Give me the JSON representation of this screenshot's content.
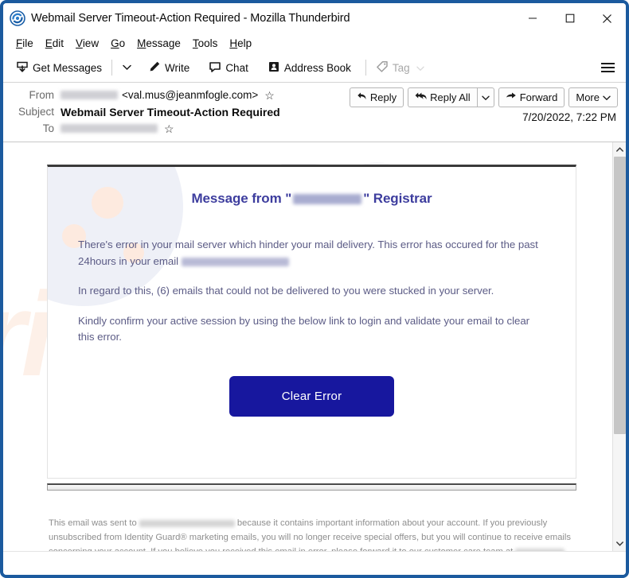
{
  "window": {
    "title": "Webmail Server Timeout-Action Required - Mozilla Thunderbird",
    "logo_icon": "thunderbird-logo-icon",
    "minimize_icon": "minimize-icon",
    "maximize_icon": "maximize-icon",
    "close_icon": "close-icon"
  },
  "menubar": {
    "items": [
      {
        "label": "File",
        "accesskey": "F"
      },
      {
        "label": "Edit",
        "accesskey": "E"
      },
      {
        "label": "View",
        "accesskey": "V"
      },
      {
        "label": "Go",
        "accesskey": "G"
      },
      {
        "label": "Message",
        "accesskey": "M"
      },
      {
        "label": "Tools",
        "accesskey": "T"
      },
      {
        "label": "Help",
        "accesskey": "H"
      }
    ]
  },
  "toolbar": {
    "get_messages": "Get Messages",
    "get_messages_icon": "download-inbox-icon",
    "get_messages_chevron_icon": "chevron-down-icon",
    "write": "Write",
    "write_icon": "pencil-icon",
    "chat": "Chat",
    "chat_icon": "chat-bubble-icon",
    "address_book": "Address Book",
    "address_book_icon": "address-card-icon",
    "tag": "Tag",
    "tag_icon": "tag-icon",
    "tag_chevron_icon": "chevron-down-icon",
    "app_menu_icon": "hamburger-menu-icon"
  },
  "message_header": {
    "from_label": "From",
    "from_name_redacted": true,
    "from_address": "<val.mus@jeanmfogle.com>",
    "from_star_icon": "star-outline-icon",
    "subject_label": "Subject",
    "subject_value": "Webmail Server Timeout-Action Required",
    "to_label": "To",
    "to_redacted": true,
    "to_star_icon": "star-outline-icon",
    "date": "7/20/2022, 7:22 PM",
    "actions": {
      "reply": "Reply",
      "reply_icon": "reply-arrow-icon",
      "reply_all": "Reply All",
      "reply_all_icon": "reply-all-arrow-icon",
      "reply_all_chevron_icon": "chevron-down-icon",
      "forward": "Forward",
      "forward_icon": "forward-arrow-icon",
      "more": "More",
      "more_chevron_icon": "chevron-down-icon"
    }
  },
  "email_body": {
    "watermark_top": "PC",
    "watermark_bottom": "risk.com",
    "heading_prefix": "Message from \"",
    "heading_redacted": true,
    "heading_suffix": "\" Registrar",
    "paragraph_1a": "There's  error in your mail server which hinder your mail delivery. This error has occured for the past 24hours in your email",
    "paragraph_1_redacted": true,
    "paragraph_2": "In regard to this, (6) emails that could not be delivered to you were stucked in your server.",
    "paragraph_3": "Kindly confirm your active session by using the below link to login and validate your email to clear this error.",
    "cta_button": "Clear Error",
    "cta_button_color": "#17179e",
    "footer_part1": "This email was sent to",
    "footer_part2": "because it contains important information about your account. If you previously unsubscribed from Identity Guard® marketing emails, you will no longer receive special offers, but you will continue to receive emails concerning your account. If you believe you received this email in error, please forward it to our customer care team at",
    "footer_redacted_1": true,
    "footer_redacted_2": true
  },
  "scrollbar": {
    "up_arrow_icon": "chevron-up-icon",
    "down_arrow_icon": "chevron-down-icon"
  }
}
